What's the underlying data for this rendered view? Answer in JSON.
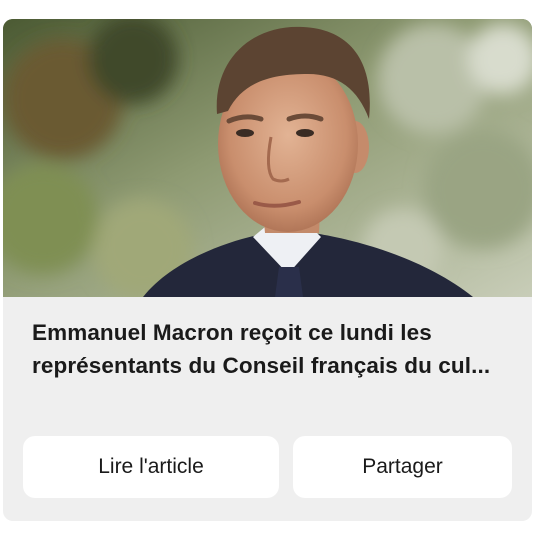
{
  "article_card": {
    "image_subject": "portrait photo of a man in a dark suit, blurred garden background",
    "headline": "Emmanuel Macron reçoit ce lundi les représentants du Conseil français du cul...",
    "buttons": {
      "read_label": "Lire l'article",
      "share_label": "Partager"
    }
  }
}
